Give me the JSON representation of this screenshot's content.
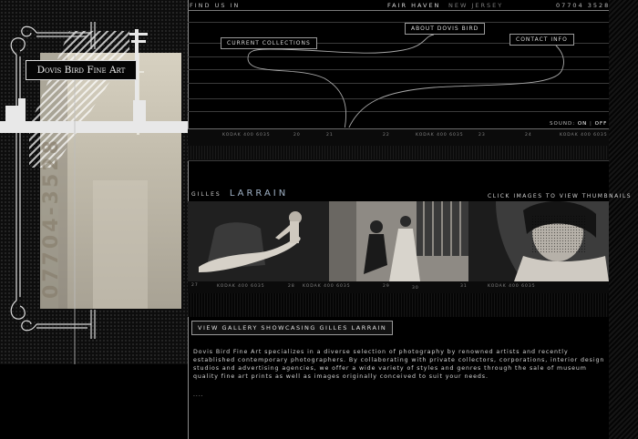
{
  "nav": {
    "find_us": "FIND US IN",
    "town": "FAIR HAVEN",
    "state": "NEW JERSEY",
    "phone": "07704 3528",
    "current_collections": "CURRENT COLLECTIONS",
    "about": "ABOUT DOVIS BIRD",
    "contact": "CONTACT INFO"
  },
  "logo": {
    "text": "Dovis Bird Fine Art"
  },
  "vertical_phone": "07704-3528",
  "sound": {
    "label": "SOUND:",
    "on": "ON",
    "sep": "|",
    "off": "OFF"
  },
  "film_top": [
    "KODAK 400 6035",
    "20",
    "21",
    "22",
    "KODAK 400 6035",
    "23",
    "24",
    "KODAK 400 6035"
  ],
  "artist": {
    "first": "GILLES",
    "last": "LARRAIN"
  },
  "click_hint": "CLICK IMAGES TO VIEW THUMBNAILS",
  "film_bottom": [
    "27",
    "KODAK 400 6035",
    "28",
    "KODAK 400 6035",
    "29",
    "30",
    "31",
    "KODAK 400 6035"
  ],
  "gallery_button": "VIEW GALLERY SHOWCASING GILLES LARRAIN",
  "description": "Dovis Bird Fine Art specializes in a diverse selection of photography by renowned artists and recently established contemporary photographers. By collaborating with private collectors, corporations, interior design studios and advertising agencies, we offer a wide variety of styles and genres through the sale of museum quality fine art prints as well as images originally conceived to suit your needs.",
  "ellipsis": "....",
  "colors": {
    "background": "#000000",
    "panel": "#0d0d0d",
    "photo_tone": "#b9b3a3",
    "line": "#8a8a8a"
  }
}
